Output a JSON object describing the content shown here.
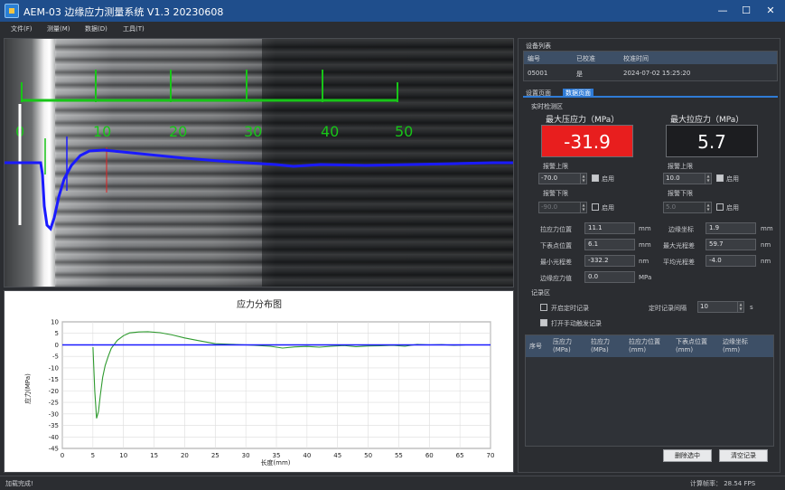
{
  "window": {
    "title": "AEM-03 边缘应力测量系统  V1.3  20230608",
    "minimize": "—",
    "maximize": "☐",
    "close": "✕"
  },
  "menu": [
    "文件(F)",
    "测量(M)",
    "数据(D)",
    "工具(T)"
  ],
  "camera": {
    "ruler_labels": [
      "0",
      "10",
      "20",
      "30",
      "40",
      "50"
    ],
    "colors": {
      "ruler": "#18c518",
      "curve": "#1a1aff",
      "marker": "#e02020"
    }
  },
  "chart": {
    "title": "应力分布图",
    "xlabel": "长度(mm)",
    "ylabel": "应力(MPa)"
  },
  "chart_data": {
    "type": "line",
    "title": "应力分布图",
    "xlabel": "长度(mm)",
    "ylabel": "应力(MPa)",
    "xlim": [
      0,
      70
    ],
    "ylim": [
      -45,
      10
    ],
    "x_ticks": [
      0,
      5,
      10,
      15,
      20,
      25,
      30,
      35,
      40,
      45,
      50,
      55,
      60,
      65,
      70
    ],
    "y_ticks": [
      10,
      5,
      0,
      -5,
      -10,
      -15,
      -20,
      -25,
      -30,
      -35,
      -40,
      -45
    ],
    "grid": true,
    "series": [
      {
        "color": "#2e9a2e",
        "x": [
          5,
          5.3,
          5.6,
          5.9,
          6.2,
          6.6,
          7.0,
          7.5,
          8.0,
          9.0,
          10.0,
          11.0,
          12.5,
          14.0,
          16.0,
          18.0,
          20.0,
          22.0,
          25.0,
          28.0,
          30.0,
          32.0,
          34.0,
          36.0,
          38.0,
          40.0,
          42.0,
          44.0,
          46.0,
          48.0,
          50.0,
          52.0,
          54.0,
          56.0,
          58.0,
          60.0,
          62.0,
          64.0,
          66.0
        ],
        "y": [
          -1,
          -20,
          -31.9,
          -29,
          -22,
          -14,
          -9,
          -5,
          -1.5,
          2,
          4,
          5.2,
          5.6,
          5.7,
          5.3,
          4.3,
          3.0,
          2.0,
          0.5,
          0.2,
          0.0,
          -0.3,
          -0.6,
          -1.4,
          -0.9,
          -0.7,
          -1.0,
          -0.6,
          -0.3,
          -0.8,
          -0.5,
          -0.4,
          -0.2,
          -0.6,
          0.2,
          0.0,
          0.1,
          -0.2,
          0.0
        ]
      },
      {
        "color": "#1a1aff",
        "x": [
          0,
          70
        ],
        "y": [
          0,
          0
        ]
      }
    ]
  },
  "right": {
    "device_list_title": "设备列表",
    "device_cols": [
      "编号",
      "已校准",
      "校准时间"
    ],
    "device_row": [
      "05001",
      "是",
      "2024-07-02 15:25:20"
    ],
    "tabs": [
      "设置页面",
      "数据页面"
    ],
    "realtime_title": "实时检测区",
    "max_comp_label": "最大压应力（MPa）",
    "max_tens_label": "最大拉应力（MPa）",
    "max_comp_value": "-31.9",
    "max_tens_value": "5.7",
    "alarm_upper": "报警上限",
    "alarm_lower": "报警下限",
    "enable": "启用",
    "comp_upper": "-70.0",
    "comp_lower": "-90.0",
    "tens_upper": "10.0",
    "tens_lower": "5.0",
    "fields": [
      {
        "label": "拉应力位置",
        "value": "11.1",
        "unit": "mm"
      },
      {
        "label": "下表点位置",
        "value": "6.1",
        "unit": "mm"
      },
      {
        "label": "最小光程差",
        "value": "-332.2",
        "unit": "nm"
      },
      {
        "label": "边缘应力值",
        "value": "0.0",
        "unit": "MPa"
      }
    ],
    "fields2": [
      {
        "label": "边缘坐标",
        "value": "1.9",
        "unit": "mm"
      },
      {
        "label": "最大光程差",
        "value": "59.7",
        "unit": "nm"
      },
      {
        "label": "平均光程差",
        "value": "-4.0",
        "unit": "nm"
      }
    ],
    "record_title": "记录区",
    "timed_record": "开启定时记录",
    "interval_label": "定时记录间隔",
    "interval_value": "10",
    "interval_unit": "s",
    "manual_record": "打开手动触发记录",
    "rec_cols": [
      "序号",
      "压应力\n(MPa)",
      "拉应力\n(MPa)",
      "拉应力位置\n(mm)",
      "下表点位置\n(mm)",
      "边缘坐标\n(mm)"
    ],
    "delete_btn": "删除选中",
    "clear_btn": "清空记录"
  },
  "status": {
    "left": "加载完成!",
    "right": "计算帧率：  28.54 FPS"
  }
}
